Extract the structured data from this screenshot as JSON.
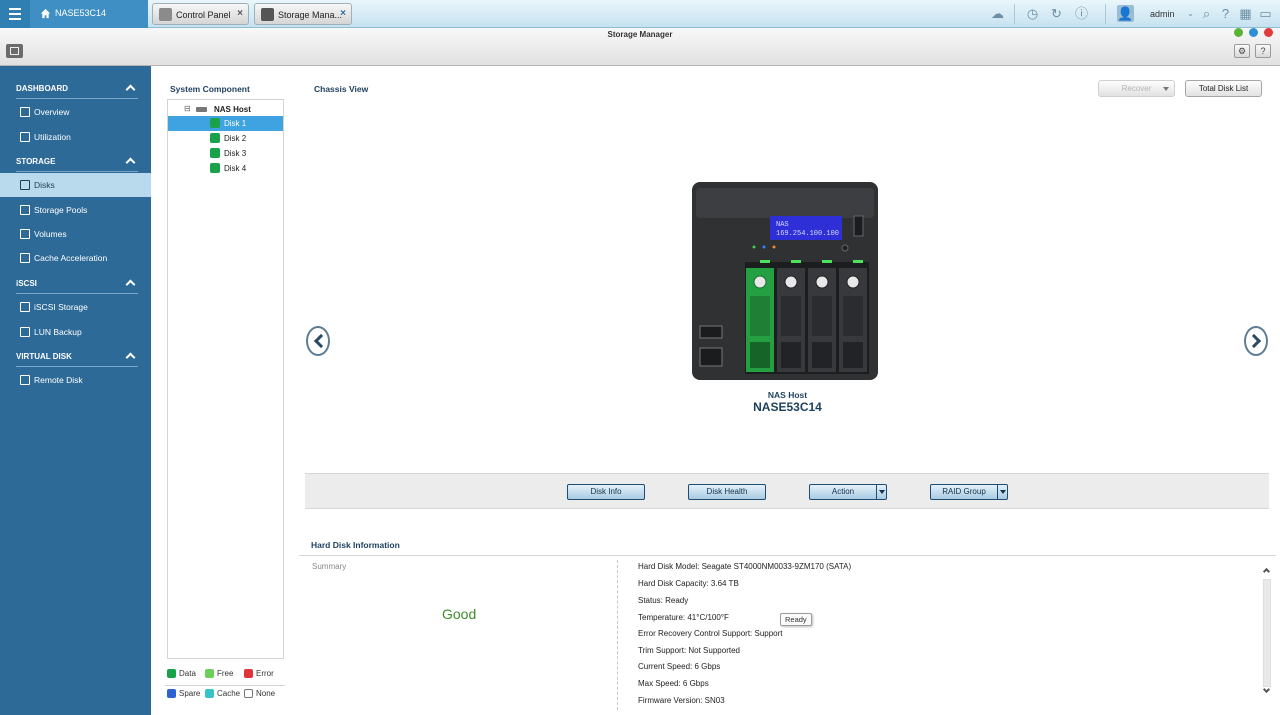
{
  "topbar": {
    "home_label": "NASE53C14",
    "tabs": [
      {
        "label": "Control Panel",
        "close": "×"
      },
      {
        "label": "Storage Mana...",
        "close": "×"
      }
    ],
    "user": "admin"
  },
  "window": {
    "title": "Storage Manager"
  },
  "sidebar": {
    "sections": [
      {
        "label": "DASHBOARD",
        "items": [
          {
            "label": "Overview"
          },
          {
            "label": "Utilization"
          }
        ]
      },
      {
        "label": "STORAGE",
        "items": [
          {
            "label": "Disks",
            "active": true
          },
          {
            "label": "Storage Pools"
          },
          {
            "label": "Volumes"
          },
          {
            "label": "Cache Acceleration"
          }
        ]
      },
      {
        "label": "iSCSI",
        "items": [
          {
            "label": "iSCSI Storage"
          },
          {
            "label": "LUN Backup"
          }
        ]
      },
      {
        "label": "VIRTUAL DISK",
        "items": [
          {
            "label": "Remote Disk"
          }
        ]
      }
    ]
  },
  "component": {
    "title": "System Component",
    "root": "NAS Host",
    "disks": [
      "Disk 1",
      "Disk 2",
      "Disk 3",
      "Disk 4"
    ],
    "selected": "Disk 1",
    "legend": [
      {
        "label": "Data",
        "color": "#19a24a"
      },
      {
        "label": "Free",
        "color": "#6cd05a"
      },
      {
        "label": "Error",
        "color": "#e0343a"
      },
      {
        "label": "Spare",
        "color": "#2e64d1"
      },
      {
        "label": "Cache",
        "color": "#38c3c8"
      },
      {
        "label": "None",
        "color": "#ffffff"
      }
    ]
  },
  "chassis": {
    "title": "Chassis View",
    "recover_label": "Recover",
    "total_disk_list_label": "Total Disk List",
    "lcd_line1": "NAS",
    "lcd_line2": "169.254.100.100",
    "host_caption": "NAS Host",
    "host_name": "NASE53C14",
    "actions": {
      "disk_info": "Disk Info",
      "disk_health": "Disk Health",
      "action": "Action",
      "raid_group": "RAID Group"
    }
  },
  "hdinfo": {
    "title": "Hard Disk Information",
    "summary_label": "Summary",
    "summary_status": "Good",
    "tooltip": "Ready",
    "rows": [
      "Hard Disk Model: Seagate ST4000NM0033-9ZM170 (SATA)",
      "Hard Disk Capacity: 3.64 TB",
      "Status: Ready",
      "Temperature: 41°C/100°F",
      "Error Recovery Control Support: Support",
      "Trim Support: Not Supported",
      "Current Speed: 6 Gbps",
      "Max Speed: 6 Gbps",
      "Firmware Version: SN03"
    ]
  },
  "colors": {
    "sidebar_bg": "#2d6a97",
    "sidebar_active": "#b9d9ec",
    "tree_selected": "#3ea3e0",
    "good_status": "#3d8b2a"
  }
}
